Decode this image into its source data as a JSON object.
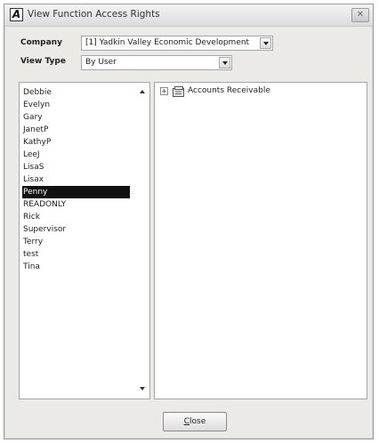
{
  "window": {
    "icon_letter": "A",
    "title": "View Function Access Rights",
    "close_glyph": "✕"
  },
  "form": {
    "company_label": "Company",
    "company_value": "[1]   Yadkin Valley Economic Development",
    "view_type_label": "View Type",
    "view_type_value": "By User"
  },
  "users": [
    "Debbie",
    "Evelyn",
    "Gary",
    "JanetP",
    "KathyP",
    "LeeJ",
    "LisaS",
    "Lisax",
    "Penny",
    "READONLY",
    "Rick",
    "Supervisor",
    "Terry",
    "test",
    "Tina"
  ],
  "selected_user": "Penny",
  "tree": {
    "expander_glyph": "+",
    "nodes": [
      {
        "label": "Accounts Receivable",
        "icon": "folder-icon"
      }
    ]
  },
  "buttons": {
    "close_accel": "C",
    "close_rest": "lose"
  },
  "colors": {
    "window_bg": "#eceae6",
    "selection_bg": "#111111",
    "selection_fg": "#ffffff"
  }
}
